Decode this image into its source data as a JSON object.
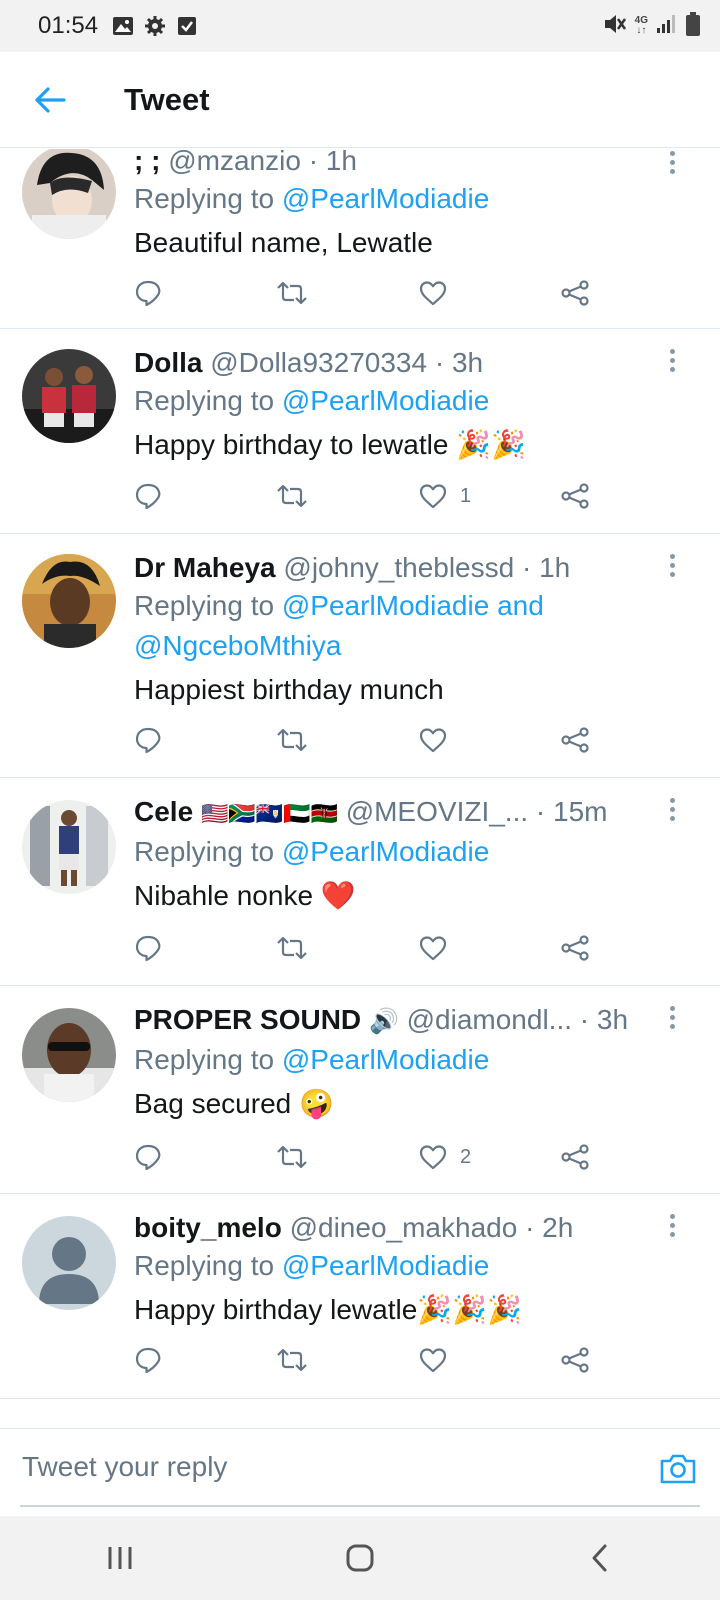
{
  "status_bar": {
    "time": "01:54",
    "left_icons": [
      "image-icon",
      "gear-icon",
      "checkbox-icon"
    ],
    "right_icons": [
      "mute-icon",
      "network-4g-icon",
      "signal-icon",
      "battery-icon"
    ],
    "network_label_top": "4G",
    "network_label_bottom": "↓↑"
  },
  "header": {
    "back_icon": "arrow-left-icon",
    "title": "Tweet"
  },
  "colors": {
    "accent": "#1da1f2",
    "secondary_text": "#657786",
    "like_red": "#e0245e"
  },
  "tweets": [
    {
      "name": "; ;",
      "handle": "@mzanzio",
      "time": "· 1h",
      "replying_prefix": "Replying to ",
      "replying_to": "@PearlModiadie",
      "replying_to_line2": "",
      "text": "Beautiful name, Lewatle",
      "emoji": "",
      "likes": ""
    },
    {
      "name": "Dolla",
      "handle": "@Dolla93270334",
      "time": "· 3h",
      "replying_prefix": "Replying to ",
      "replying_to": "@PearlModiadie",
      "replying_to_line2": "",
      "text": "Happy birthday to lewatle ",
      "emoji": "🎉🎉",
      "likes": "1"
    },
    {
      "name": "Dr Maheya",
      "handle": "@johny_theblessd",
      "time": "· 1h",
      "replying_prefix": "Replying to ",
      "replying_to": "@PearlModiadie and",
      "replying_to_line2": "@NgceboMthiya",
      "text": "Happiest birthday munch",
      "emoji": "",
      "likes": ""
    },
    {
      "name": "Cele",
      "name_emoji": "🇺🇸🇿🇦🇦🇮🇦🇪🇰🇪",
      "handle": "@MEOVIZI_...",
      "time": "· 15m",
      "replying_prefix": "Replying to ",
      "replying_to": "@PearlModiadie",
      "replying_to_line2": "",
      "text": "Nibahle nonke ",
      "emoji": "❤️",
      "likes": ""
    },
    {
      "name": "PROPER SOUND",
      "name_emoji": "🔊",
      "handle": "@diamondl...",
      "time": "· 3h",
      "replying_prefix": "Replying to ",
      "replying_to": "@PearlModiadie",
      "replying_to_line2": "",
      "text": "Bag secured ",
      "emoji": "🤪",
      "likes": "2"
    },
    {
      "name": "boity_melo",
      "handle": "@dineo_makhado",
      "time": "· 2h",
      "replying_prefix": "Replying to ",
      "replying_to": "@PearlModiadie",
      "replying_to_line2": "",
      "text": "Happy birthday lewatle",
      "emoji": "🎉🎉🎉",
      "likes": ""
    }
  ],
  "reply_bar": {
    "placeholder": "Tweet your reply",
    "camera_icon": "camera-icon"
  },
  "nav_bar": {
    "icons": [
      "recent-apps-icon",
      "home-icon",
      "back-icon"
    ]
  }
}
